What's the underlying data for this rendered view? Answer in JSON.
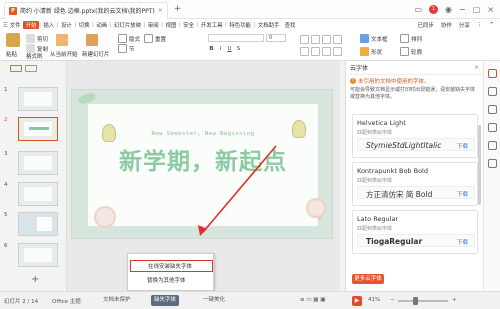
{
  "titlebar": {
    "doc_title": "简约 小清新 绿色 边框.pptx(我的云文档\\我的PPT)",
    "close": "×",
    "new_tab": "+",
    "notify_count": "1"
  },
  "menubar": {
    "items": [
      "三 文件",
      "开始",
      "插入",
      "设计",
      "切换",
      "动画",
      "幻灯片放映",
      "审阅",
      "视图",
      "安全",
      "开发工具",
      "特色功能",
      "文档助手",
      "查找"
    ],
    "active_index": 1,
    "right": [
      "已同步",
      "协作",
      "分享",
      "⋮",
      "^"
    ]
  },
  "ribbon": {
    "paste": "粘贴",
    "cut": "剪切",
    "copy": "复制",
    "format_painter": "格式刷",
    "from_current": "从当前开始",
    "new_slide": "新建幻灯片",
    "layout": "版式",
    "section": "节",
    "reset": "重置",
    "font_select": "",
    "size_select": "0",
    "bold": "B",
    "italic": "I",
    "underline": "U",
    "shadow": "S",
    "textbox": "文本框",
    "shapes": "形状",
    "arrange": "排列",
    "outline": "轮廓"
  },
  "slides": [
    {
      "num": "1"
    },
    {
      "num": "2"
    },
    {
      "num": "3"
    },
    {
      "num": "4"
    },
    {
      "num": "5"
    },
    {
      "num": "6"
    }
  ],
  "slide": {
    "subtitle": "New Semester, New Beginning",
    "title": "新学期，新起点"
  },
  "context_menu": {
    "items": [
      "在线安装缺失字体",
      "替换为其他字体"
    ]
  },
  "font_panel": {
    "title": "云字体",
    "warning": "未引用的文档中使用的字体。",
    "desc": "可能会导致文档显示或打印时出现错误，请安装缺失字体或替换为其他字体。",
    "fonts": [
      {
        "name": "Helvetica Light",
        "sub": "匹配到类似字体",
        "preview": "StymieStdLightItalic",
        "download": "下载"
      },
      {
        "name": "Kontrapunkt Bob Bold",
        "sub": "匹配到类似字体",
        "preview": "方正清仿宋 简 Bold",
        "download": "下载"
      },
      {
        "name": "Lato Regular",
        "sub": "匹配到类似字体",
        "preview": "TiogaRegular",
        "download": "下载"
      }
    ],
    "more_button": "更多云字体",
    "close": "×"
  },
  "statusbar": {
    "slide_count": "幻灯片 2 / 14",
    "theme": "Office 主题",
    "doc_protect": "文档未保护",
    "missing_font": "缺失字体",
    "beautify": "一键美化",
    "zoom": "41%",
    "minus": "−",
    "plus": "+"
  }
}
